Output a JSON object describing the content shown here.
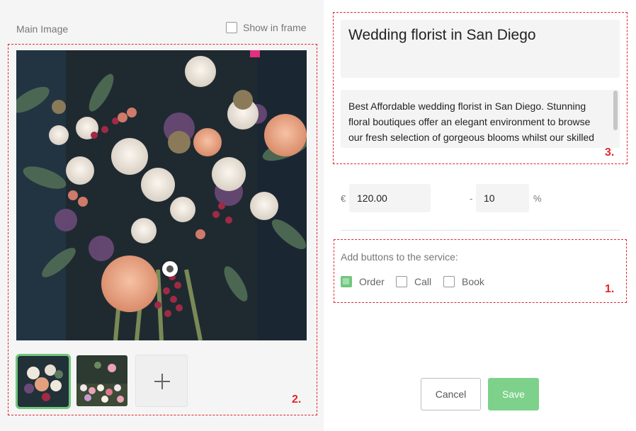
{
  "image_panel": {
    "label": "Main Image",
    "show_in_frame": {
      "label": "Show in frame",
      "checked": false
    },
    "main_image": {
      "description_icon": "bouquet-photo",
      "focal_point_icon": "focal-point-icon"
    },
    "thumbnails": [
      {
        "icon": "bouquet-thumbnail",
        "selected": true
      },
      {
        "icon": "flower-market-thumbnail",
        "selected": false
      }
    ],
    "add_image_icon": "plus-icon"
  },
  "service": {
    "title": "Wedding florist in San Diego",
    "description": "Best Affordable wedding florist in San Diego. Stunning floral boutiques offer an elegant environment to browse our fresh selection of gorgeous blooms whilst our skilled"
  },
  "pricing": {
    "currency": "€",
    "price": "120.00",
    "separator": "-",
    "discount": "10",
    "discount_unit": "%"
  },
  "buttons_section": {
    "label": "Add buttons to the service:",
    "options": [
      {
        "label": "Order",
        "checked": true
      },
      {
        "label": "Call",
        "checked": false
      },
      {
        "label": "Book",
        "checked": false
      }
    ]
  },
  "actions": {
    "cancel": "Cancel",
    "save": "Save"
  },
  "annotations": {
    "marker1": "1.",
    "marker2": "2.",
    "marker3": "3."
  },
  "colors": {
    "accent": "#7dd18a",
    "annotation": "#e0262b",
    "left_panel_bg": "#f5f5f5"
  }
}
